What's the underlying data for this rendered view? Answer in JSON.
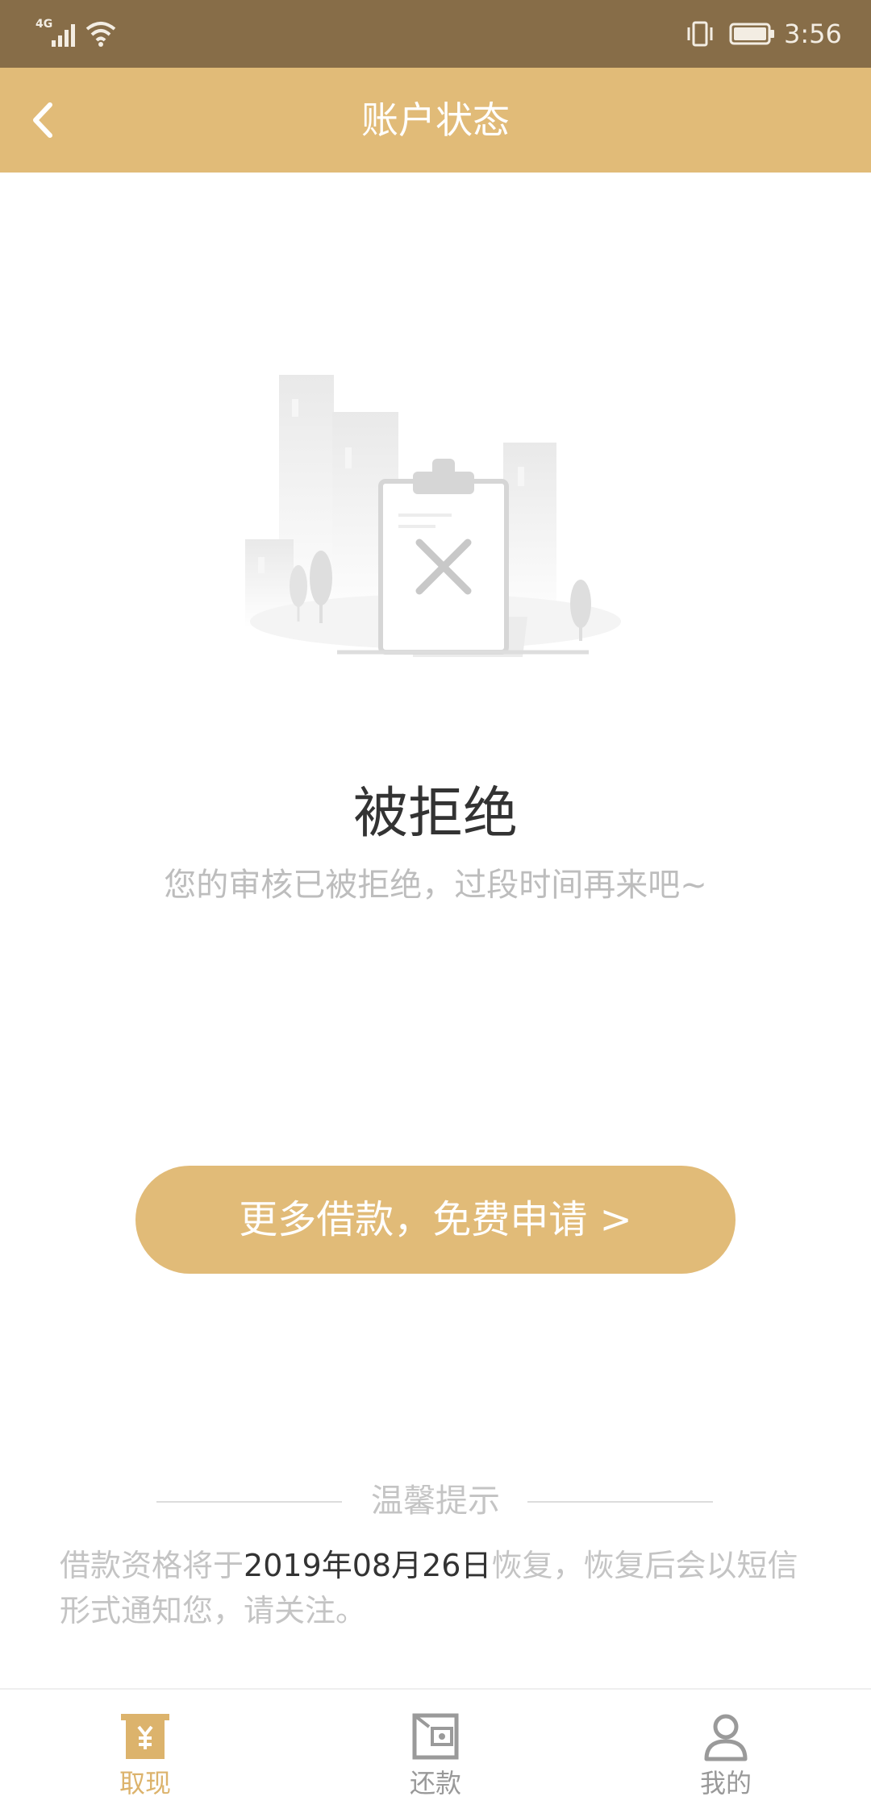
{
  "status_bar": {
    "network": "4G",
    "time": "3:56"
  },
  "header": {
    "title": "账户状态"
  },
  "status": {
    "heading": "被拒绝",
    "description": "您的审核已被拒绝，过段时间再来吧~"
  },
  "action": {
    "apply_label": "更多借款，免费申请 >"
  },
  "tips": {
    "title": "温馨提示",
    "text_before": "借款资格将于",
    "date": "2019年08月26日",
    "text_after": "恢复，恢复后会以短信形式通知您，请关注。"
  },
  "bottom_nav": {
    "items": [
      {
        "label": "取现",
        "icon": "withdraw-icon",
        "active": true
      },
      {
        "label": "还款",
        "icon": "wallet-icon",
        "active": false
      },
      {
        "label": "我的",
        "icon": "profile-icon",
        "active": false
      }
    ]
  },
  "colors": {
    "status_bar": "#876d48",
    "accent": "#e1bb78",
    "active_tab": "#dcb36c",
    "heading": "#333333",
    "muted": "#bdbdbd"
  }
}
